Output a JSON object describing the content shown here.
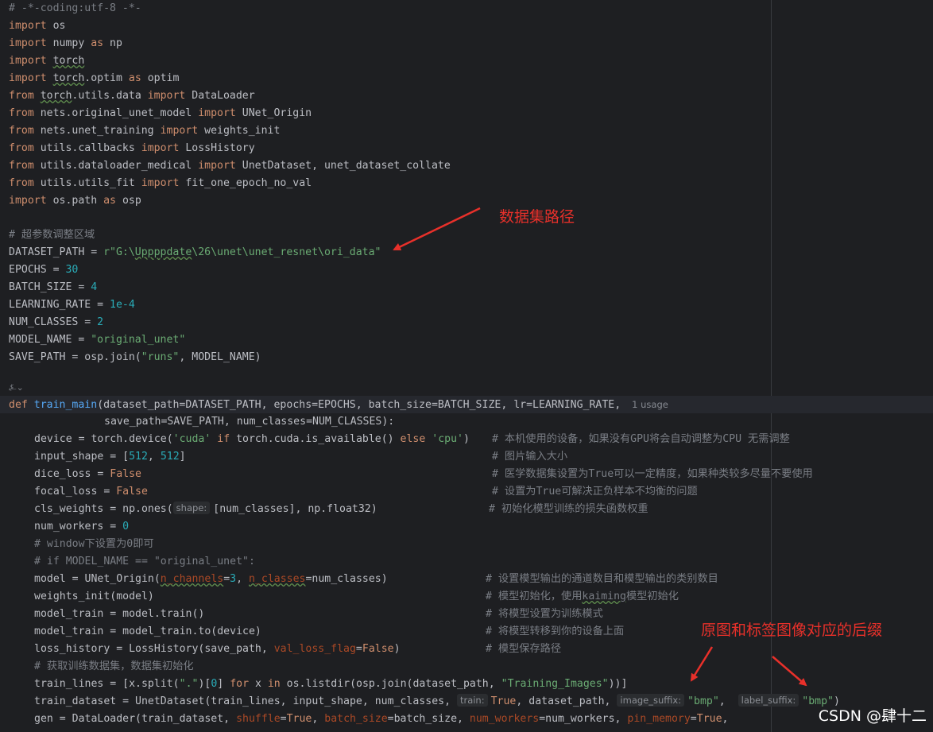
{
  "annotations": {
    "dataset_path": "数据集路径",
    "suffix": "原图和标签图像对应的后缀"
  },
  "watermark": "CSDN @肆十二",
  "fold_marker": "⍼⌄",
  "usage_hint": "1 usage",
  "param_hints": {
    "shape": "shape:",
    "n_channels": "n_channels",
    "n_classes": "n_classes",
    "train": "train:",
    "image_suffix": "image_suffix:",
    "label_suffix": "label_suffix:"
  },
  "code": {
    "l01": "# -*-coding:utf-8 -*-",
    "l02a": "import",
    "l02b": " os",
    "l03a": "import",
    "l03b": " numpy ",
    "l03c": "as",
    "l03d": " np",
    "l04a": "import",
    "l04b": "torch",
    "l05a": "import",
    "l05b": "torch",
    "l05c": ".optim ",
    "l05d": "as",
    "l05e": " optim",
    "l06a": "from",
    "l06b": "torch",
    "l06c": ".utils.data ",
    "l06d": "import",
    "l06e": " DataLoader",
    "l07a": "from",
    "l07b": " nets.original_unet_model ",
    "l07c": "import",
    "l07d": " UNet_Origin",
    "l08a": "from",
    "l08b": " nets.unet_training ",
    "l08c": "import",
    "l08d": " weights_init",
    "l09a": "from",
    "l09b": " utils.callbacks ",
    "l09c": "import",
    "l09d": " LossHistory",
    "l10a": "from",
    "l10b": " utils.dataloader_medical ",
    "l10c": "import",
    "l10d": " UnetDataset, unet_dataset_collate",
    "l11a": "from",
    "l11b": " utils.utils_fit ",
    "l11c": "import",
    "l11d": " fit_one_epoch_no_val",
    "l12a": "import",
    "l12b": " os.path ",
    "l12c": "as",
    "l12d": " osp",
    "l14": "# 超参数调整区域",
    "l15a": "DATASET_PATH = ",
    "l15b": "r\"G:\\",
    "l15c": "Uppppdate",
    "l15d": "\\26\\unet\\unet_resnet\\ori_data\"",
    "l16a": "EPOCHS = ",
    "l16b": "30",
    "l17a": "BATCH_SIZE = ",
    "l17b": "4",
    "l18a": "LEARNING_RATE = ",
    "l18b": "1e-4",
    "l19a": "NUM_CLASSES = ",
    "l19b": "2",
    "l20a": "MODEL_NAME = ",
    "l20b": "\"original_unet\"",
    "l21a": "SAVE_PATH = osp.join(",
    "l21b": "\"runs\"",
    "l21c": ", MODEL_NAME)",
    "l23a": "def",
    "l23b": "train_main",
    "l23c": "(dataset_path=DATASET_PATH, epochs=EPOCHS, batch_size=BATCH_SIZE, lr=LEARNING_RATE,",
    "l24": "save_path=SAVE_PATH, num_classes=NUM_CLASSES):",
    "l25a": "device = torch.device(",
    "l25b": "'cuda'",
    "l25c": "if",
    "l25d": " torch.cuda.is_available() ",
    "l25e": "else",
    "l25f": "'cpu'",
    "l25g": ")",
    "l25h": "# 本机使用的设备，如果没有GPU将会自动调整为CPU 无需调整",
    "l26a": "input_shape = [",
    "l26b": "512",
    "l26c": ", ",
    "l26d": "512",
    "l26e": "]",
    "l26f": "# 图片输入大小",
    "l27a": "dice_loss = ",
    "l27b": "False",
    "l27c": "# 医学数据集设置为True可以一定精度，如果种类较多尽量不要使用",
    "l28a": "focal_loss = ",
    "l28b": "False",
    "l28c": "# 设置为True可解决正负样本不均衡的问题",
    "l29a": "cls_weights = np.ones(",
    "l29b": "[num_classes], np.float32)",
    "l29c": "# 初始化模型训练的损失函数权重",
    "l30a": "num_workers = ",
    "l30b": "0",
    "l31": "# window下设置为0即可",
    "l32": "# if MODEL_NAME == \"original_unet\":",
    "l33a": "model = UNet_Origin(",
    "l33b": "=",
    "l33c": "3",
    "l33d": ", ",
    "l33e": "=num_classes)",
    "l33f": "# 设置模型输出的通道数目和模型输出的类别数目",
    "l34a": "weights_init(model)",
    "l34b": "# 模型初始化，使用",
    "l34c": "kaiming",
    "l34d": "模型初始化",
    "l35a": "model_train = model.train()",
    "l35b": "# 将模型设置为训练模式",
    "l36a": "model_train = model_train.to(device)",
    "l36b": "# 将模型转移到你的设备上面",
    "l37a": "loss_history = LossHistory(save_path, ",
    "l37b": "val_loss_flag",
    "l37c": "=",
    "l37d": "False",
    "l37e": ")",
    "l37f": "# 模型保存路径",
    "l38": "# 获取训练数据集，数据集初始化",
    "l39a": "train_lines = [x.split(",
    "l39b": "\".\"",
    "l39c": ")[",
    "l39d": "0",
    "l39e": "] ",
    "l39f": "for",
    "l39g": " x ",
    "l39h": "in",
    "l39i": " os.listdir(osp.join(dataset_path, ",
    "l39j": "\"Training_Images\"",
    "l39k": "))]",
    "l40a": "train_dataset = UnetDataset(train_lines, input_shape, num_classes, ",
    "l40b": "True",
    "l40c": ", dataset_path, ",
    "l40d": "\"bmp\"",
    "l40e": ", ",
    "l40f": "\"bmp\"",
    "l40g": ")",
    "l41a": "gen = DataLoader(train_dataset, ",
    "l41b": "shuffle",
    "l41c": "=",
    "l41d": "True",
    "l41e": ", ",
    "l41f": "batch_size",
    "l41g": "=batch_size, ",
    "l41h": "num_workers",
    "l41i": "=num_workers, ",
    "l41j": "pin_memory",
    "l41k": "=",
    "l41l": "True",
    "l41m": ","
  }
}
